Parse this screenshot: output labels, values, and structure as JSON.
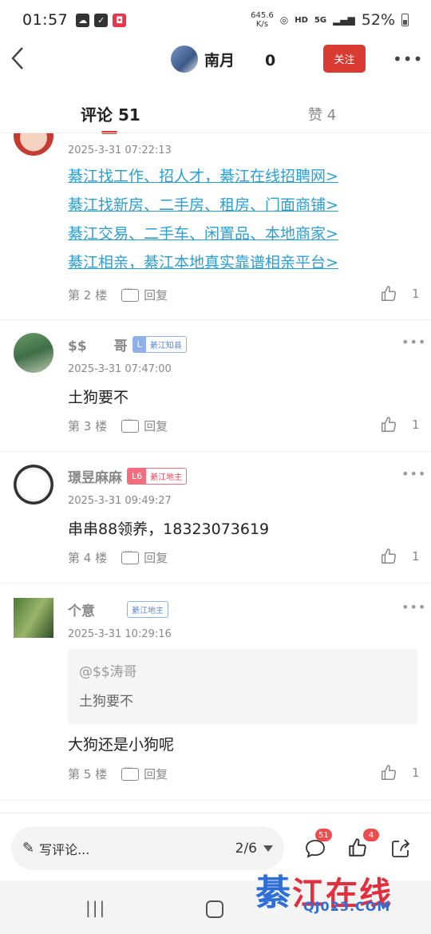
{
  "status_bar": {
    "time": "01:57",
    "net_speed_value": "645.6",
    "net_speed_unit": "K/s",
    "hd": "HD",
    "signal_5g": "5G",
    "battery": "52%"
  },
  "header": {
    "author_name": "南月　　0",
    "follow_label": "关注",
    "more_label": "•••"
  },
  "tabs": {
    "comments": "评论 51",
    "likes": "赞 4"
  },
  "comments": [
    {
      "timestamp": "2025-3-31 07:22:13",
      "links": [
        "綦江找工作、招人才，綦江在线招聘网>",
        "綦江找新房、二手房、租房、门面商铺>",
        "綦江交易、二手车、闲置品、本地商家>",
        "綦江相亲，綦江本地真实靠谱相亲平台>"
      ],
      "floor": "第 2 楼",
      "reply_label": "回复",
      "likes": "1"
    },
    {
      "author": "$$　　哥",
      "level": "L",
      "level_title": "綦江知县",
      "timestamp": "2025-3-31 07:47:00",
      "text": "土狗要不",
      "floor": "第 3 楼",
      "reply_label": "回复",
      "likes": "1"
    },
    {
      "author": "璟昱麻麻",
      "level": "L6",
      "level_title": "綦江地主",
      "timestamp": "2025-3-31 09:49:27",
      "text": "串串88领养，18323073619",
      "floor": "第 4 楼",
      "reply_label": "回复",
      "likes": "1"
    },
    {
      "author": "个意　　",
      "level": "",
      "level_title": "綦江地主",
      "timestamp": "2025-3-31 10:29:16",
      "quote_author": "@$$涛哥",
      "quote_text": "土狗要不",
      "text": "大狗还是小狗呢",
      "floor": "第 5 楼",
      "reply_label": "回复",
      "likes": "1"
    }
  ],
  "bottom_bar": {
    "write_placeholder": "写评论...",
    "page_indicator": "2/6",
    "comment_count": "51",
    "like_count": "4"
  },
  "watermark": {
    "text_a": "綦",
    "text_b": "江在线",
    "url": "QJ023.COM"
  },
  "colors": {
    "accent_red": "#d93a32",
    "link_blue": "#2a9fd6",
    "badge_red": "#ef4d4d"
  }
}
